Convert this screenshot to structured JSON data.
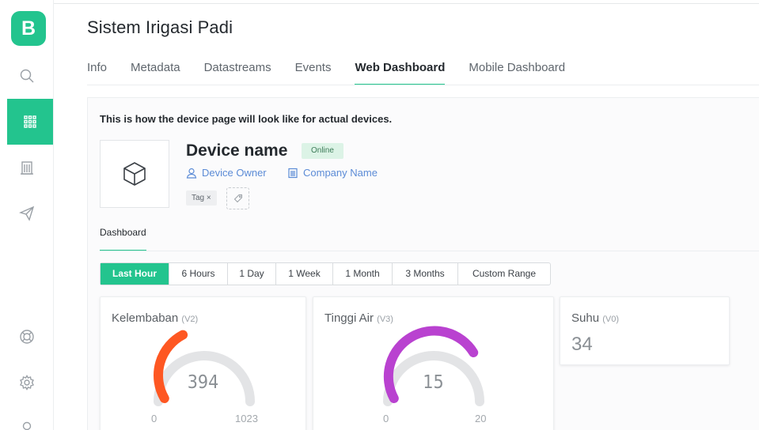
{
  "sidebar": {
    "logo": "B",
    "icons": [
      "search-icon",
      "grid-icon",
      "building-icon",
      "send-icon",
      "lifebuoy-icon",
      "gear-icon",
      "circle-icon"
    ]
  },
  "header": {
    "title": "Sistem Irigasi Padi",
    "tabs": [
      {
        "label": "Info"
      },
      {
        "label": "Metadata"
      },
      {
        "label": "Datastreams"
      },
      {
        "label": "Events"
      },
      {
        "label": "Web Dashboard",
        "active": true
      },
      {
        "label": "Mobile Dashboard"
      }
    ]
  },
  "device": {
    "notice": "This is how the device page will look like for actual devices.",
    "name": "Device name",
    "status": "Online",
    "owner": "Device Owner",
    "company": "Company Name",
    "tag": "Tag ×"
  },
  "dashboard": {
    "tab": "Dashboard",
    "ranges": [
      "Last Hour",
      "6 Hours",
      "1 Day",
      "1 Week",
      "1 Month",
      "3 Months",
      "Custom Range"
    ],
    "active_range": "Last Hour",
    "widgets": [
      {
        "title": "Kelembaban",
        "pin": "(V2)",
        "value": "394",
        "min": "0",
        "max": "1023",
        "fraction": 0.385,
        "color": "#fe5722"
      },
      {
        "title": "Tinggi Air",
        "pin": "(V3)",
        "value": "15",
        "min": "0",
        "max": "20",
        "fraction": 0.75,
        "color": "#b942d0"
      },
      {
        "title": "Suhu",
        "pin": "(V0)",
        "value": "34"
      }
    ]
  },
  "colors": {
    "accent": "#23c48e",
    "link": "#5b8bd6"
  }
}
